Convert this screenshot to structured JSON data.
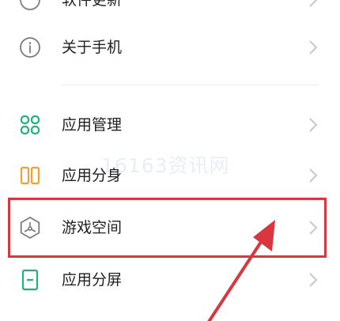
{
  "menu": {
    "top_partial_label": "软件更新",
    "about_label": "关于手机",
    "app_manage_label": "应用管理",
    "app_clone_label": "应用分身",
    "game_space_label": "游戏空间",
    "split_screen_label": "应用分屏"
  },
  "watermark": "16163资讯网",
  "icons": {
    "top": "update-icon",
    "about": "info-icon",
    "app_manage": "app-grid-icon",
    "app_clone": "dual-app-icon",
    "game_space": "game-space-icon",
    "split_screen": "split-screen-icon",
    "chevron": "chevron-right-icon"
  },
  "colors": {
    "accent_green": "#23b07a",
    "accent_orange": "#f0a03a",
    "highlight_red": "#d9363e",
    "text": "#1f1f1f",
    "chevron": "#c8c8c8"
  }
}
